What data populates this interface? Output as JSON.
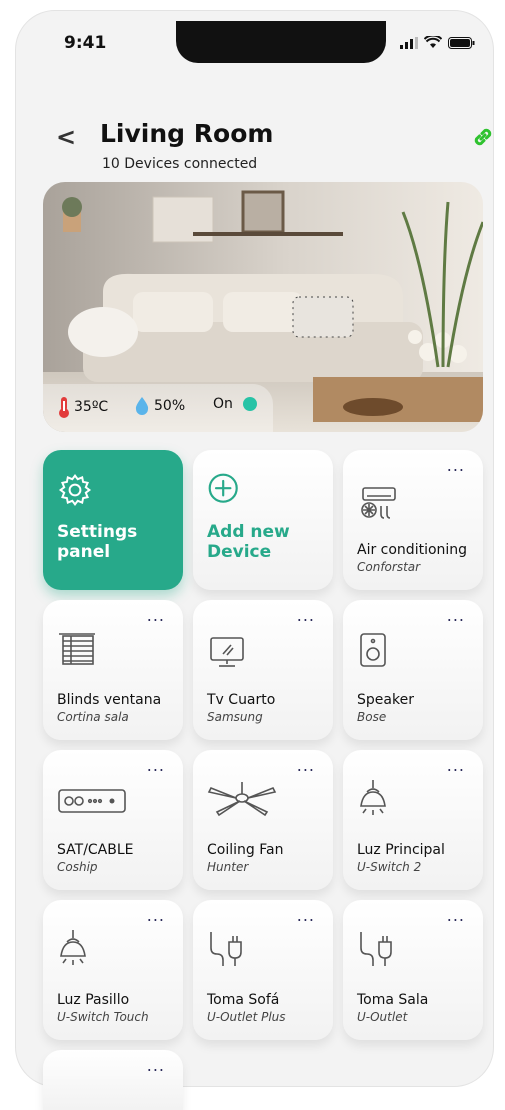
{
  "status": {
    "time": "9:41"
  },
  "header": {
    "title": "Living Room",
    "subtitle": "10 Devices connected"
  },
  "hero": {
    "temperature": "35ºC",
    "humidity": "50%",
    "power": "On"
  },
  "actions": {
    "settings_line1": "Settings",
    "settings_line2": "panel",
    "add_line1": "Add new",
    "add_line2": "Device"
  },
  "devices": [
    {
      "name": "Air conditioning",
      "brand": "Conforstar",
      "icon": "air-conditioner-icon"
    },
    {
      "name": "Blinds ventana",
      "brand": "Cortina sala",
      "icon": "blinds-icon"
    },
    {
      "name": "Tv Cuarto",
      "brand": "Samsung",
      "icon": "tv-icon"
    },
    {
      "name": "Speaker",
      "brand": "Bose",
      "icon": "speaker-icon"
    },
    {
      "name": "SAT/CABLE",
      "brand": "Coship",
      "icon": "set-top-box-icon"
    },
    {
      "name": "Coiling Fan",
      "brand": "Hunter",
      "icon": "ceiling-fan-icon"
    },
    {
      "name": "Luz Principal",
      "brand": "U-Switch 2",
      "icon": "pendant-lamp-icon"
    },
    {
      "name": "Luz Pasillo",
      "brand": "U-Switch Touch",
      "icon": "pendant-lamp-icon"
    },
    {
      "name": "Toma Sofá",
      "brand": "U-Outlet Plus",
      "icon": "plug-icon"
    },
    {
      "name": "Toma Sala",
      "brand": "U-Outlet",
      "icon": "plug-icon"
    }
  ],
  "more_label": "...",
  "colors": {
    "accent": "#27a98a",
    "link": "#2ec22e",
    "temp": "#e23b3b",
    "water": "#5ab4ea"
  }
}
